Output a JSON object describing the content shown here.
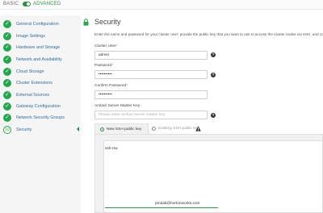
{
  "mode": {
    "basic_label": "BASIC",
    "advanced_label": "ADVANCED"
  },
  "sidebar": {
    "steps": [
      {
        "label": "General Configuration",
        "icon": "check-icon",
        "state": "done"
      },
      {
        "label": "Image Settings",
        "icon": "check-icon",
        "state": "done"
      },
      {
        "label": "Hardware and Storage",
        "icon": "check-icon",
        "state": "done"
      },
      {
        "label": "Network and Availability",
        "icon": "check-icon",
        "state": "done"
      },
      {
        "label": "Cloud Storage",
        "icon": "check-icon",
        "state": "done"
      },
      {
        "label": "Cluster Extensions",
        "icon": "check-icon",
        "state": "done"
      },
      {
        "label": "External Sources",
        "icon": "check-icon",
        "state": "done"
      },
      {
        "label": "Gateway Configuration",
        "icon": "check-icon",
        "state": "done"
      },
      {
        "label": "Network Security Groups",
        "icon": "check-icon",
        "state": "done"
      },
      {
        "label": "Security",
        "number": "10",
        "state": "active"
      }
    ]
  },
  "main": {
    "title": "Security",
    "description": "Enter the name and password for your cluster user; provide the public key that you want to use to access the cluster nodes via SSH, and co",
    "cluster_user": {
      "label": "Cluster User",
      "required_mark": "*",
      "value": "admin"
    },
    "password": {
      "label": "Password",
      "required_mark": "*",
      "value": "••••••••••"
    },
    "confirm_password": {
      "label": "Confirm Password",
      "required_mark": "*",
      "value": "••••••••••"
    },
    "ambari_key": {
      "label": "Ambari Server Master Key",
      "placeholder": "Please enter ambari server master key"
    },
    "ssh": {
      "tab_new": "New SSH public key",
      "tab_existing": "Existing SSH public key",
      "key_start": "ssh-rsa",
      "key_end": "pmdali@hortonworks.com"
    }
  },
  "colors": {
    "accent_green": "#21a84a",
    "link_blue": "#2d6da3",
    "required_red": "#d9534f"
  }
}
